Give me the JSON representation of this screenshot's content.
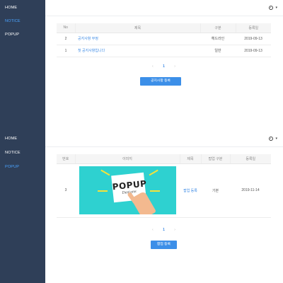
{
  "screen1": {
    "sidebar": {
      "items": [
        "HOME",
        "NOTICE",
        "POPUP"
      ],
      "active_index": 1
    },
    "table": {
      "headers": [
        "No",
        "제목",
        "구분",
        "등록일"
      ],
      "rows": [
        {
          "no": "2",
          "title": "공지사항 부정",
          "category": "헤드라인",
          "date": "2019-09-13"
        },
        {
          "no": "1",
          "title": "첫 공지사항입니다",
          "category": "일반",
          "date": "2019-09-13"
        }
      ]
    },
    "pager": {
      "prev": "‹",
      "current": "1",
      "next": "›"
    },
    "register_button": "공지사항 등록"
  },
  "screen2": {
    "sidebar": {
      "items": [
        "HOME",
        "NOTICE",
        "POPUP"
      ],
      "active_index": 2
    },
    "table": {
      "headers": [
        "번호",
        "이미지",
        "제목",
        "팝업 구분",
        "등록일"
      ],
      "rows": [
        {
          "no": "3",
          "image": {
            "word": "POPUP",
            "script": "Designs",
            "bg_color": "#2ed1d0"
          },
          "title": "팝업 등록",
          "category": "기본",
          "date": "2019-11-14"
        }
      ]
    },
    "pager": {
      "prev": "‹",
      "current": "1",
      "next": "›"
    },
    "register_button": "팝업 등록"
  },
  "colors": {
    "sidebar_bg": "#2f3f58",
    "active_nav": "#4aa3ff",
    "accent": "#3c8fe8",
    "link": "#3d8be6"
  },
  "icons": {
    "settings": "gear-icon",
    "menu_caret": "caret-down-icon"
  }
}
